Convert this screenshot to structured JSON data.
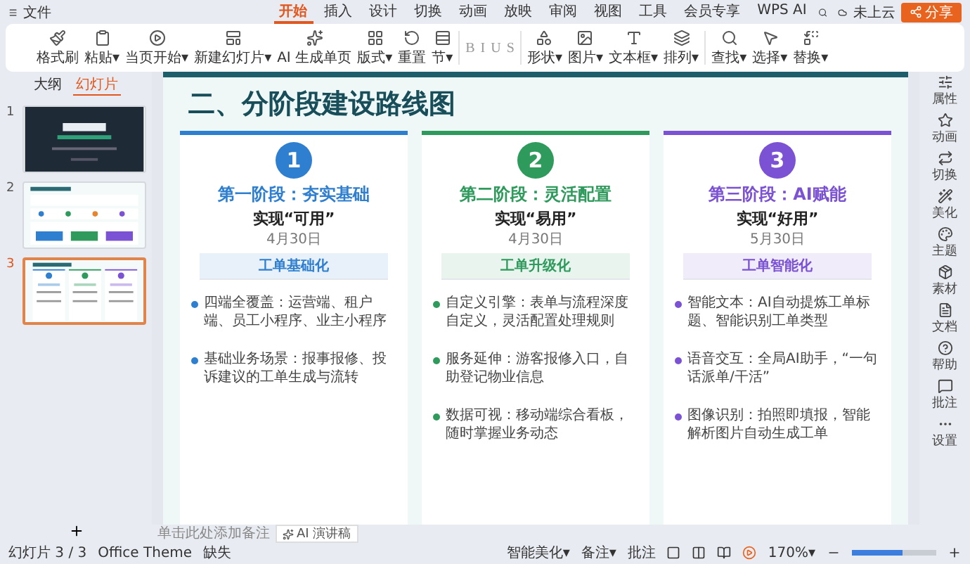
{
  "menu_bar": {
    "file": "文件",
    "tabs": [
      {
        "label": "开始",
        "selected": true
      },
      {
        "label": "插入",
        "selected": false
      },
      {
        "label": "设计",
        "selected": false
      },
      {
        "label": "切换",
        "selected": false
      },
      {
        "label": "动画",
        "selected": false
      },
      {
        "label": "放映",
        "selected": false
      },
      {
        "label": "审阅",
        "selected": false
      },
      {
        "label": "视图",
        "selected": false
      },
      {
        "label": "工具",
        "selected": false
      },
      {
        "label": "会员专享",
        "selected": false
      },
      {
        "label": "WPS AI",
        "selected": false
      }
    ],
    "cloud": "未上云",
    "share": "分享"
  },
  "ribbon": {
    "buttons": [
      "格式刷",
      "粘贴▾",
      "当页开始▾",
      "新建幻灯片▾",
      "AI 生成单页",
      "版式▾",
      "重置",
      "节▾"
    ],
    "format": [
      "B",
      "I",
      "U",
      "S"
    ],
    "insert": [
      "形状▾",
      "图片▾",
      "文本框▾",
      "排列▾"
    ],
    "edit": [
      "查找▾",
      "选择▾",
      "替换▾"
    ]
  },
  "panel": {
    "tabs": [
      {
        "label": "大纲",
        "selected": false
      },
      {
        "label": "幻灯片",
        "selected": true
      }
    ],
    "slides": [
      {
        "number": "1",
        "selected": false
      },
      {
        "number": "2",
        "selected": false
      },
      {
        "number": "3",
        "selected": true
      }
    ]
  },
  "slide": {
    "title": "二、分阶段建设路线图",
    "stages": [
      {
        "number": "1",
        "color": "#2f7fd0",
        "heading": "第一阶段：夯实基础",
        "goal": "实现“可用”",
        "date": "4月30日",
        "tag": "工单基础化",
        "points": [
          "四端全覆盖：运营端、租户端、员工小程序、业主小程序",
          "基础业务场景：报事报修、投诉建议的工单生成与流转"
        ]
      },
      {
        "number": "2",
        "color": "#2e9a5c",
        "heading": "第二阶段：灵活配置",
        "goal": "实现“易用”",
        "date": "4月30日",
        "tag": "工单升级化",
        "points": [
          "自定义引擎：表单与流程深度自定义，灵活配置处理规则",
          "服务延伸：游客报修入口，自助登记物业信息",
          "数据可视：移动端综合看板，随时掌握业务动态"
        ]
      },
      {
        "number": "3",
        "color": "#7b52d3",
        "heading": "第三阶段：AI赋能",
        "goal": "实现“好用”",
        "date": "5月30日",
        "tag": "工单智能化",
        "points": [
          "智能文本：AI自动提炼工单标题、智能识别工单类型",
          "语音交互：全局AI助手，“一句话派单/干活”",
          "图像识别：拍照即填报，智能解析图片自动生成工单"
        ]
      }
    ]
  },
  "notes": {
    "placeholder": "单击此处添加备注",
    "ai_button": "AI 演讲稿"
  },
  "sidebar": [
    "属性",
    "动画",
    "切换",
    "美化",
    "主题",
    "素材",
    "文档",
    "帮助",
    "批注",
    "设置"
  ],
  "status_bar": {
    "slide_count": "幻灯片 3 / 3",
    "theme": "Office Theme",
    "font": "缺失",
    "beautify": "智能美化▾",
    "notes": "备注▾",
    "comments": "批注",
    "zoom": "170%▾",
    "level": 0.6
  }
}
